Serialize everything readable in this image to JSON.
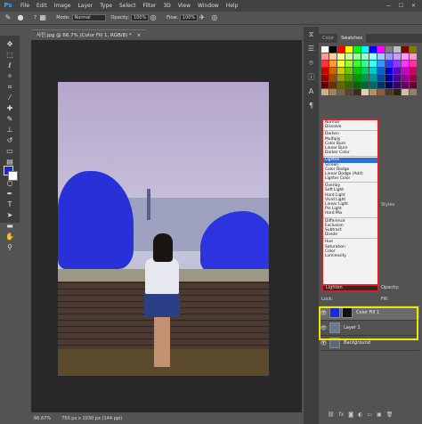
{
  "app": {
    "logo": "Ps"
  },
  "menu": [
    "File",
    "Edit",
    "Image",
    "Layer",
    "Type",
    "Select",
    "Filter",
    "3D",
    "View",
    "Window",
    "Help"
  ],
  "window_controls": [
    "—",
    "☐",
    "✕"
  ],
  "options_bar": {
    "brush_size": "7",
    "mode_label": "Mode:",
    "mode_value": "Normal",
    "opacity_label": "Opacity:",
    "opacity_value": "100%",
    "flow_label": "Flow:",
    "flow_value": "100%"
  },
  "document_tab": {
    "title": "사진.jpg @ 66.7% (Color Fill 1, RGB/8) *",
    "close": "×"
  },
  "status_bar": {
    "zoom": "66.67%",
    "doc_info": "750 px x 1030 px (144 ppi)"
  },
  "right_panel": {
    "tabs": [
      "Color",
      "Swatches"
    ],
    "active_tab": "Swatches",
    "styles_label": "Styles"
  },
  "swatch_colors": [
    "#ffffff",
    "#000000",
    "#ff0000",
    "#ffff00",
    "#00ff00",
    "#00ffff",
    "#0000ff",
    "#ff00ff",
    "#7f7f7f",
    "#c0c0c0",
    "#800000",
    "#808000",
    "#ff9999",
    "#ffcc99",
    "#ffff99",
    "#ccff99",
    "#99ff99",
    "#99ffcc",
    "#99ffff",
    "#99ccff",
    "#9999ff",
    "#cc99ff",
    "#ff99ff",
    "#ff99cc",
    "#ff3333",
    "#ff9933",
    "#ffff33",
    "#99ff33",
    "#33ff33",
    "#33ff99",
    "#33ffff",
    "#3399ff",
    "#3333ff",
    "#9933ff",
    "#ff33ff",
    "#ff3399",
    "#cc0000",
    "#cc6600",
    "#cccc00",
    "#66cc00",
    "#00cc00",
    "#00cc66",
    "#00cccc",
    "#0066cc",
    "#0000cc",
    "#6600cc",
    "#cc00cc",
    "#cc0066",
    "#990000",
    "#994c00",
    "#999900",
    "#4c9900",
    "#009900",
    "#00994c",
    "#009999",
    "#004c99",
    "#000099",
    "#4c0099",
    "#990099",
    "#99004c",
    "#660000",
    "#663300",
    "#666600",
    "#336600",
    "#006600",
    "#006633",
    "#006666",
    "#003366",
    "#000066",
    "#330066",
    "#660066",
    "#660033",
    "#c8b48c",
    "#a08460",
    "#7c6448",
    "#584430",
    "#3c2c1c",
    "#e0d0b0",
    "#b09070",
    "#806040",
    "#503820",
    "#302010",
    "#d0c0a0",
    "#908070"
  ],
  "blend_modes": [
    [
      "Normal",
      "Dissolve"
    ],
    [
      "Darken",
      "Multiply",
      "Color Burn",
      "Linear Burn",
      "Darker Color"
    ],
    [
      "Lighten",
      "Screen",
      "Color Dodge",
      "Linear Dodge (Add)",
      "Lighter Color"
    ],
    [
      "Overlay",
      "Soft Light",
      "Hard Light",
      "Vivid Light",
      "Linear Light",
      "Pin Light",
      "Hard Mix"
    ],
    [
      "Difference",
      "Exclusion",
      "Subtract",
      "Divide"
    ],
    [
      "Hue",
      "Saturation",
      "Color",
      "Luminosity"
    ]
  ],
  "selected_blend": "Lighten",
  "blend_select_value": "Lighten",
  "layer_controls": {
    "opacity_label": "Opacity:",
    "fill_label": "Fill:",
    "lock_label": "Lock:"
  },
  "layers": [
    {
      "name": "Color Fill 1",
      "active": true,
      "thumb_color": "#1a2ad8",
      "italic": false
    },
    {
      "name": "Layer 1",
      "active": false,
      "thumb_color": "#6a7a8c",
      "italic": false
    },
    {
      "name": "Background",
      "active": false,
      "thumb_color": "#5a6a7c",
      "italic": true
    }
  ],
  "colors": {
    "fg": "#1a2ad8",
    "bg": "#ffffff",
    "highlight_red": "#e01e1e",
    "highlight_yellow": "#f1e600"
  }
}
